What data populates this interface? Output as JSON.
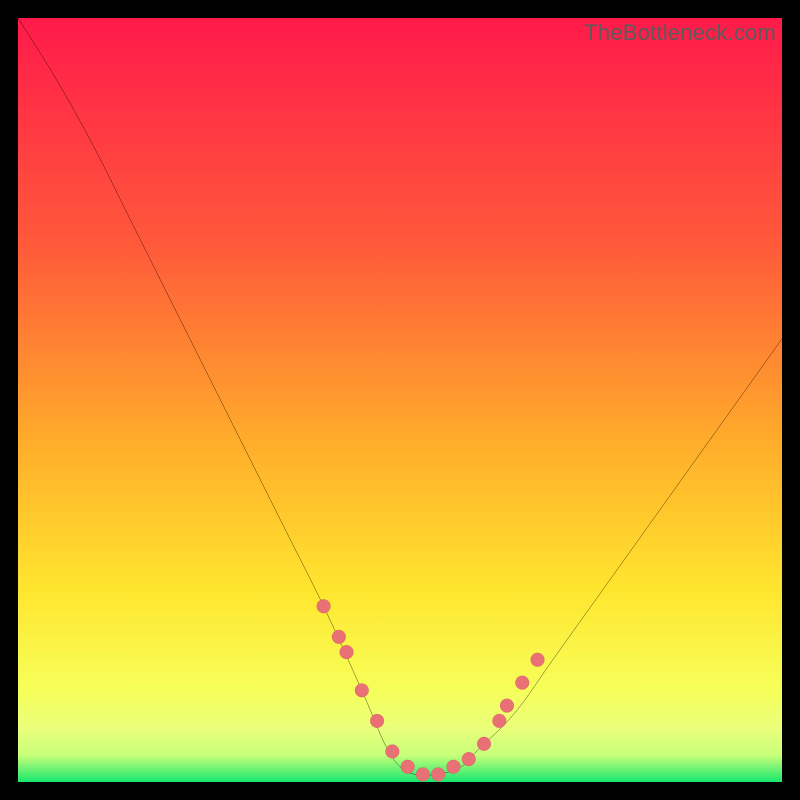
{
  "watermark": {
    "text": "TheBottleneck.com"
  },
  "colors": {
    "grad_top": "#ff1a4a",
    "grad_mid1": "#ff8a2a",
    "grad_mid2": "#ffe62e",
    "grad_high": "#f6ff5a",
    "grad_bottom": "#17e86f",
    "curve": "#000000",
    "dots_fill": "#e97074",
    "dots_stroke": "#c94a52",
    "frame_bg": "#000000"
  },
  "chart_data": {
    "type": "line",
    "title": "",
    "xlabel": "",
    "ylabel": "",
    "xlim": [
      0,
      100
    ],
    "ylim": [
      0,
      100
    ],
    "series": [
      {
        "name": "bottleneck-curve",
        "x": [
          0,
          5,
          10,
          15,
          20,
          25,
          30,
          35,
          40,
          45,
          48,
          50,
          52,
          55,
          58,
          60,
          65,
          70,
          75,
          80,
          85,
          90,
          95,
          100
        ],
        "y": [
          100,
          92,
          83,
          73,
          63,
          53,
          43,
          33,
          23,
          12,
          5,
          2,
          1,
          1,
          2,
          4,
          9,
          16,
          23,
          30,
          37,
          44,
          51,
          58
        ]
      }
    ],
    "marked_points": {
      "name": "highlighted-dots",
      "x": [
        40,
        42,
        43,
        45,
        47,
        49,
        51,
        53,
        55,
        57,
        59,
        61,
        63,
        64,
        66,
        68
      ],
      "y": [
        23,
        19,
        17,
        12,
        8,
        4,
        2,
        1,
        1,
        2,
        3,
        5,
        8,
        10,
        13,
        16
      ]
    },
    "gradient_bands": [
      {
        "from_y": 100,
        "to_y": 25,
        "color_desc": "red-to-orange"
      },
      {
        "from_y": 25,
        "to_y": 10,
        "color_desc": "orange-to-yellow"
      },
      {
        "from_y": 10,
        "to_y": 3,
        "color_desc": "yellow-pale"
      },
      {
        "from_y": 3,
        "to_y": 0,
        "color_desc": "green"
      }
    ]
  }
}
